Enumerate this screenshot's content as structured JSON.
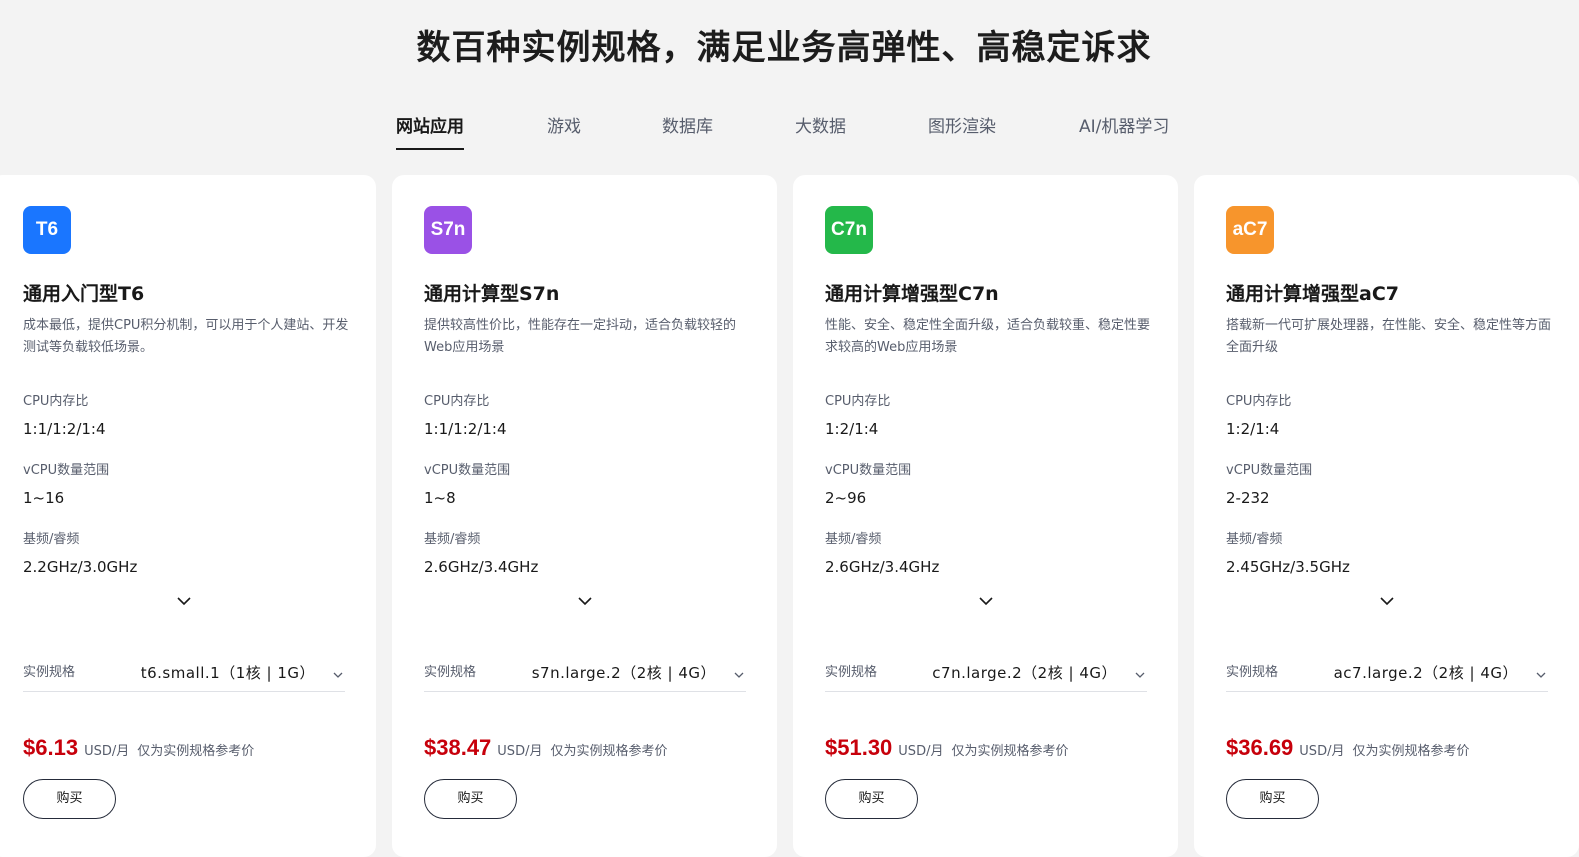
{
  "page_title": "数百种实例规格，满足业务高弹性、高稳定诉求",
  "tabs": [
    {
      "label": "网站应用",
      "active": true
    },
    {
      "label": "游戏",
      "active": false
    },
    {
      "label": "数据库",
      "active": false
    },
    {
      "label": "大数据",
      "active": false
    },
    {
      "label": "图形渲染",
      "active": false
    },
    {
      "label": "AI/机器学习",
      "active": false
    }
  ],
  "labels": {
    "cpu_ratio": "CPU内存比",
    "vcpu_range": "vCPU数量范围",
    "frequency": "基频/睿频",
    "instance_spec": "实例规格",
    "price_unit": "USD/月",
    "price_note": "仅为实例规格参考价",
    "buy": "购买"
  },
  "cards": [
    {
      "badge": "T6",
      "badge_color": "#1a76ff",
      "title": "通用入门型T6",
      "desc": "成本最低，提供CPU积分机制，可以用于个人建站、开发测试等负载较低场景。",
      "cpu_ratio": "1:1/1:2/1:4",
      "vcpu_range": "1~16",
      "frequency": "2.2GHz/3.0GHz",
      "spec": "t6.small.1（1核 | 1G）",
      "price": "$6.13"
    },
    {
      "badge": "S7n",
      "badge_color": "#9a51e6",
      "title": "通用计算型S7n",
      "desc": "提供较高性价比，性能存在一定抖动，适合负载较轻的Web应用场景",
      "cpu_ratio": "1:1/1:2/1:4",
      "vcpu_range": "1~8",
      "frequency": "2.6GHz/3.4GHz",
      "spec": "s7n.large.2（2核 | 4G）",
      "price": "$38.47"
    },
    {
      "badge": "C7n",
      "badge_color": "#24b84a",
      "title": "通用计算增强型C7n",
      "desc": "性能、安全、稳定性全面升级，适合负载较重、稳定性要求较高的Web应用场景",
      "cpu_ratio": "1:2/1:4",
      "vcpu_range": "2~96",
      "frequency": "2.6GHz/3.4GHz",
      "spec": "c7n.large.2（2核 | 4G）",
      "price": "$51.30"
    },
    {
      "badge": "aC7",
      "badge_color": "#f7952c",
      "title": "通用计算增强型aC7",
      "desc": "搭载新一代可扩展处理器，在性能、安全、稳定性等方面全面升级",
      "cpu_ratio": "1:2/1:4",
      "vcpu_range": "2-232",
      "frequency": "2.45GHz/3.5GHz",
      "spec": "ac7.large.2（2核 | 4G）",
      "price": "$36.69"
    }
  ],
  "icons": {
    "expand": "chevron-down-icon",
    "select": "chevron-down-icon"
  }
}
